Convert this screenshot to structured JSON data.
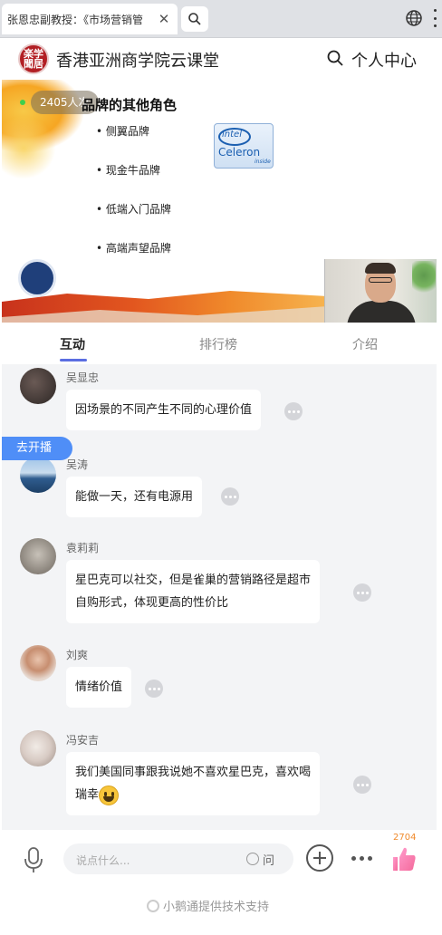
{
  "browser": {
    "tab_title": "张恩忠副教授：《市场营销管",
    "tab_close": "✕"
  },
  "app": {
    "title": "香港亚洲商学院云课堂",
    "logo_text": "楽学聞居",
    "profile_label": "个人中心"
  },
  "video": {
    "viewers": "2405人次",
    "slide_title": "品牌的其他角色",
    "bullets": [
      "• 侧翼品牌",
      "• 现金牛品牌",
      "• 低端入门品牌",
      "• 高端声望品牌"
    ],
    "intel": {
      "brand": "intel",
      "product": "Celeron",
      "tag": "inside"
    }
  },
  "tabs": {
    "items": [
      "互动",
      "排行榜",
      "介绍"
    ],
    "active": "互动",
    "accent": "#5b6ee1"
  },
  "chat": {
    "messages": [
      {
        "user": "吴显忠",
        "text": "因场景的不同产生不同的心理价值"
      },
      {
        "user": "吴涛",
        "text": "能做一天，还有电源用"
      },
      {
        "user": "袁莉莉",
        "lines": [
          "星巴克可以社交，但是雀巢的营销路径是超市",
          "自购形式，体现更高的性价比"
        ]
      },
      {
        "user": "刘爽",
        "text": "情绪价值"
      },
      {
        "user": "冯安吉",
        "lines": [
          "我们美国同事跟我说她不喜欢星巴克，喜欢喝",
          "瑞幸"
        ]
      }
    ]
  },
  "go_live": "去开播",
  "input": {
    "placeholder": "说点什么...",
    "ask_label": "问"
  },
  "likes": {
    "count": "2704"
  },
  "footer": {
    "powered_by": "小鹅通提供技术支持"
  },
  "colors": {
    "live_button": "#4f8ef7",
    "like_count": "#f08a2b"
  }
}
